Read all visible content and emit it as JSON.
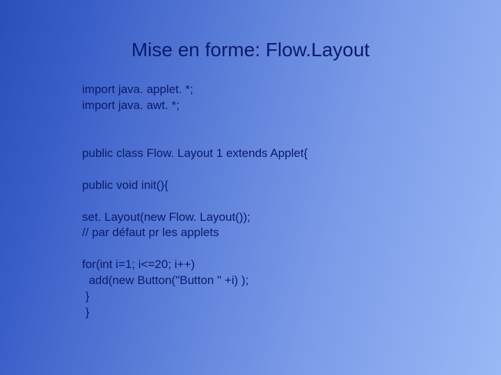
{
  "title": "Mise en forme: Flow.Layout",
  "code": {
    "l1": "import java. applet. *;",
    "l2": "import java. awt. *;",
    "l3": "",
    "l4": "",
    "l5": "public class Flow. Layout 1 extends Applet{",
    "l6": "",
    "l7": "public void init(){",
    "l8": "",
    "l9": "set. Layout(new Flow. Layout());",
    "l10": "// par défaut pr les applets",
    "l11": "",
    "l12": "for(int i=1; i<=20; i++)",
    "l13": "  add(new Button(\"Button \" +i) );",
    "l14": " }",
    "l15": " }"
  }
}
